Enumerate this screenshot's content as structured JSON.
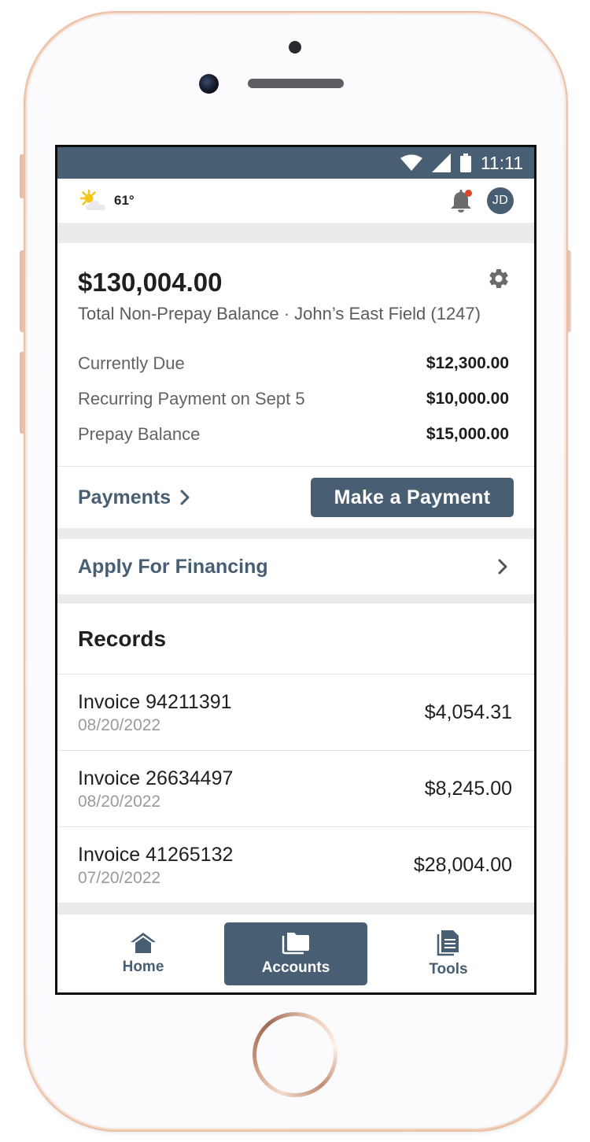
{
  "status_bar": {
    "time": "11:11"
  },
  "header": {
    "temperature": "61°",
    "avatar_initials": "JD"
  },
  "balance": {
    "total": "$130,004.00",
    "subtitle": "Total Non-Prepay Balance · John’s East Field (1247)",
    "rows": [
      {
        "label": "Currently Due",
        "value": "$12,300.00"
      },
      {
        "label": "Recurring Payment on Sept 5",
        "value": "$10,000.00"
      },
      {
        "label": "Prepay Balance",
        "value": "$15,000.00"
      }
    ],
    "payments_link": "Payments",
    "make_payment_label": "Make a Payment"
  },
  "financing": {
    "label": "Apply For Financing"
  },
  "records": {
    "title": "Records",
    "items": [
      {
        "name": "Invoice 94211391",
        "date": "08/20/2022",
        "amount": "$4,054.31"
      },
      {
        "name": "Invoice 26634497",
        "date": "08/20/2022",
        "amount": "$8,245.00"
      },
      {
        "name": "Invoice 41265132",
        "date": "07/20/2022",
        "amount": "$28,004.00"
      }
    ]
  },
  "tab_bar": {
    "tabs": [
      {
        "label": "Home",
        "icon": "home-icon",
        "active": false
      },
      {
        "label": "Accounts",
        "icon": "folders-icon",
        "active": true
      },
      {
        "label": "Tools",
        "icon": "document-icon",
        "active": false
      }
    ]
  },
  "colors": {
    "primary": "#485e72",
    "notification": "#e0452c",
    "background": "#ebebeb"
  }
}
